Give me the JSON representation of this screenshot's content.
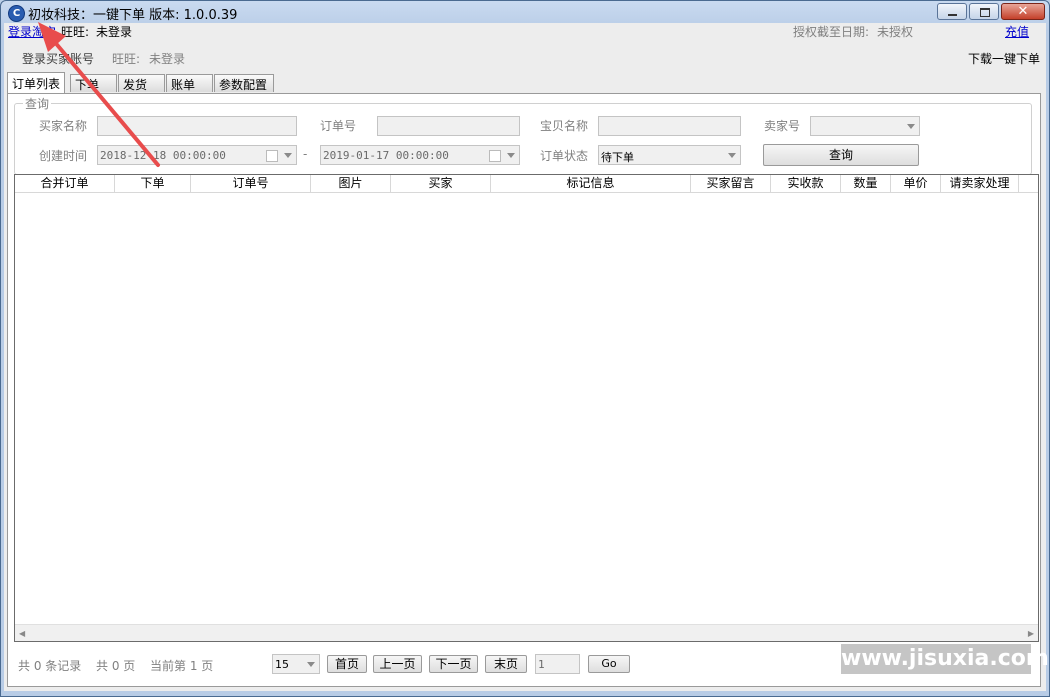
{
  "window": {
    "title": "初妆科技：一键下单    版本: 1.0.0.39",
    "icon_glyph": "C",
    "buttons": {
      "minimize": "minimize-icon",
      "maximize": "maximize-icon",
      "close_glyph": "✕"
    }
  },
  "topbar": {
    "login_link": "登录淘宝",
    "wangwang_label": "旺旺:",
    "wangwang_value": "未登录",
    "license_label": "授权截至日期:",
    "license_value": "未授权",
    "recharge_link": "充值",
    "buyer_login_button": "登录买家账号",
    "buyer_wangwang_label": "旺旺:",
    "buyer_wangwang_value": "未登录",
    "download_link": "下载一键下单"
  },
  "tabs": [
    {
      "label": "订单列表",
      "active": true
    },
    {
      "label": "下单",
      "active": false
    },
    {
      "label": "发货",
      "active": false
    },
    {
      "label": "账单",
      "active": false
    },
    {
      "label": "参数配置",
      "active": false
    }
  ],
  "query": {
    "legend": "查询",
    "buyer_name_label": "买家名称",
    "buyer_name_value": "",
    "order_no_label": "订单号",
    "order_no_value": "",
    "item_name_label": "宝贝名称",
    "item_name_value": "",
    "seller_label": "卖家号",
    "seller_value": "",
    "created_label": "创建时间",
    "date_from": "2018-12-18 00:00:00",
    "date_separator": "-",
    "date_to": "2019-01-17 00:00:00",
    "status_label": "订单状态",
    "status_value": "待下单",
    "search_button": "查询"
  },
  "table": {
    "columns": [
      "合并订单",
      "下单",
      "订单号",
      "图片",
      "买家",
      "标记信息",
      "买家留言",
      "实收款",
      "数量",
      "单价",
      "请卖家处理"
    ],
    "rows": []
  },
  "pagination": {
    "total_records": "共 0 条记录",
    "total_pages": "共 0 页",
    "current_page": "当前第 1 页",
    "page_size": "15",
    "first": "首页",
    "prev": "上一页",
    "next": "下一页",
    "last": "末页",
    "goto_value": "1",
    "go": "Go"
  },
  "watermark": "www.jisuxia.com",
  "annotation": {
    "arrow_color": "#e84c4c"
  },
  "colors": {
    "link": "#0000cc",
    "title_bar": "#c9daf0",
    "disabled_text": "#808080"
  }
}
